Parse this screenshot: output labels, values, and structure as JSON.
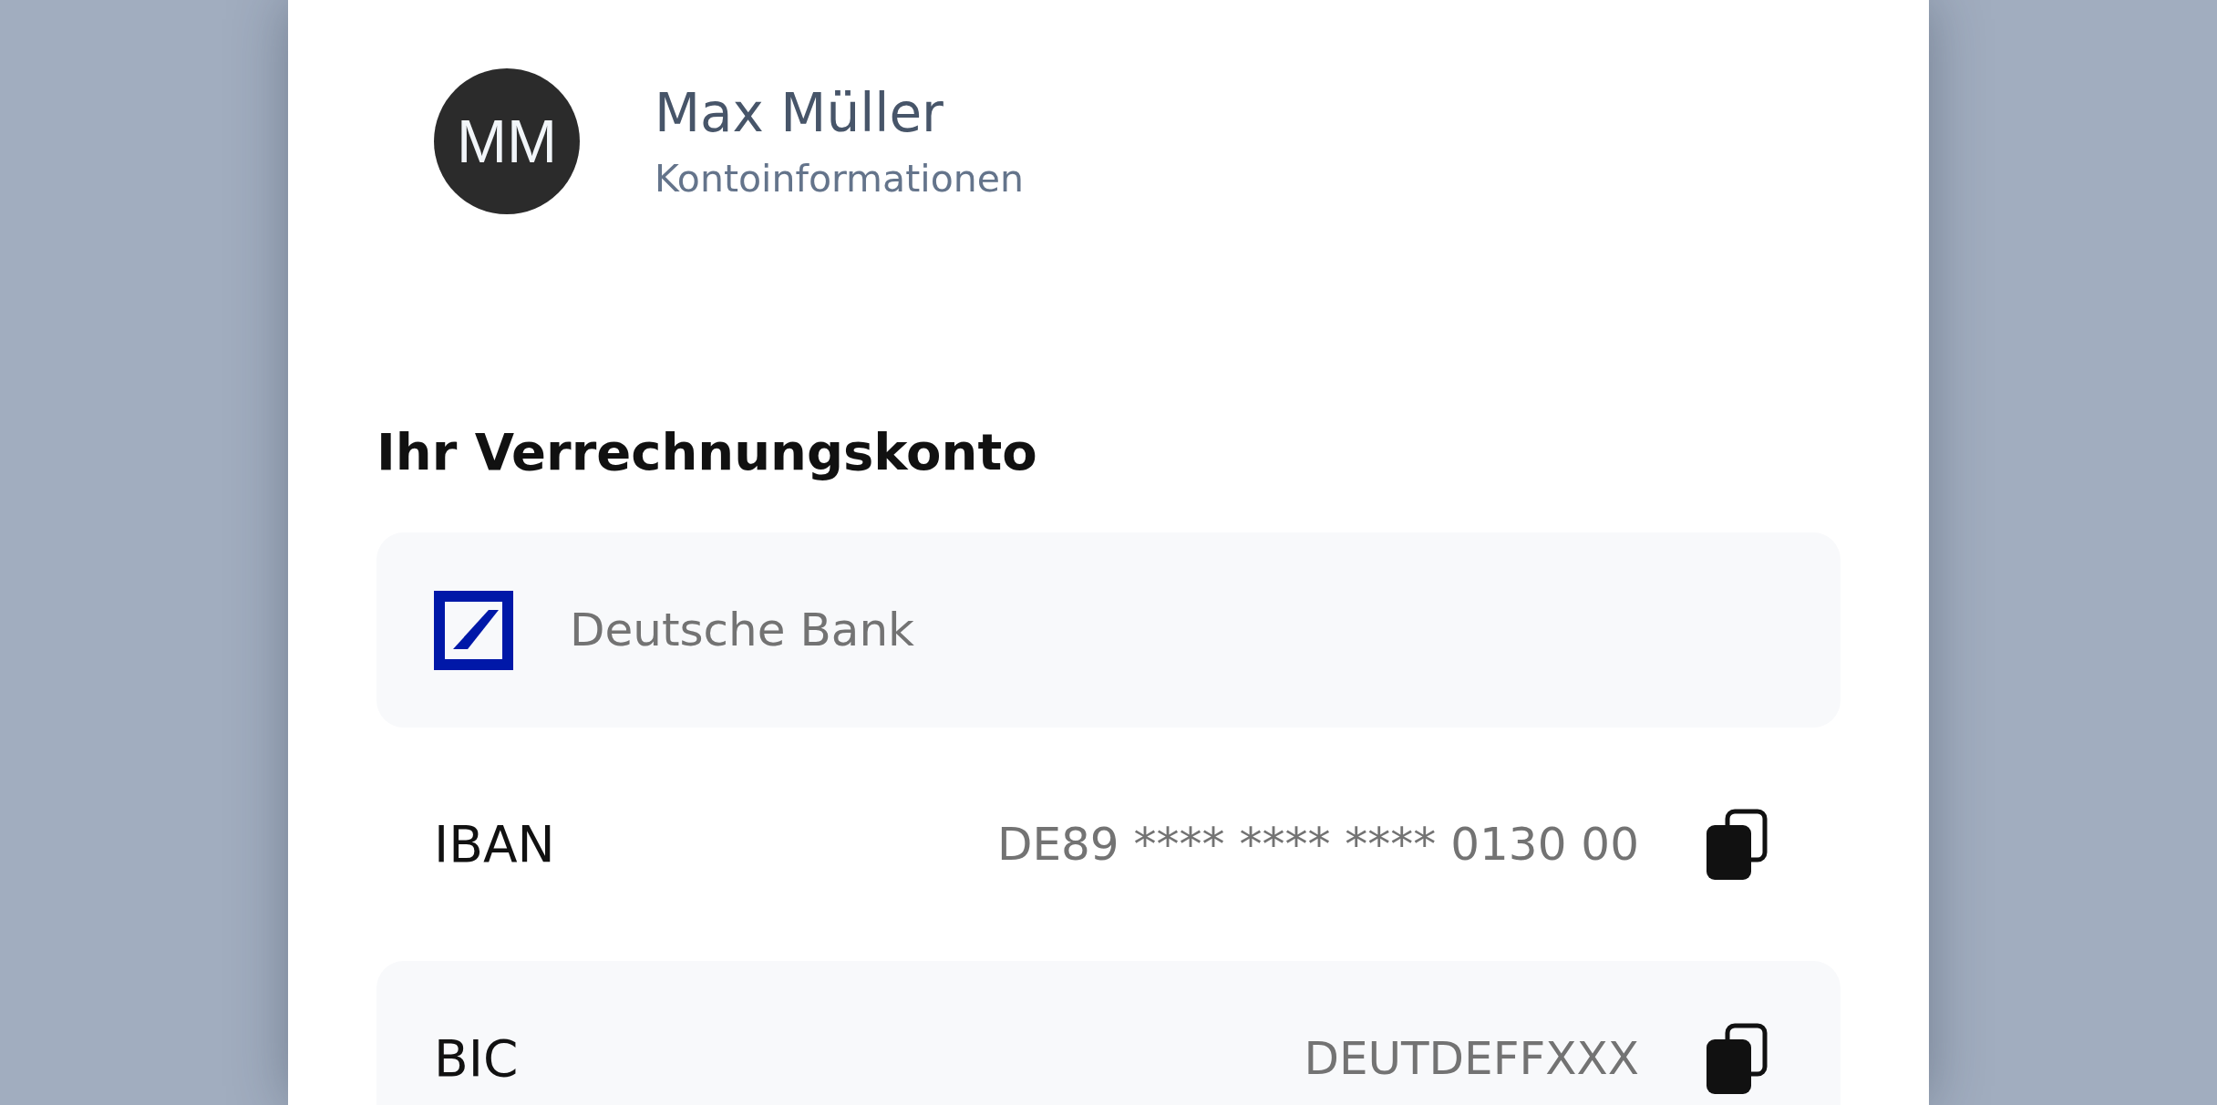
{
  "profile": {
    "initials": "MM",
    "name": "Max Müller",
    "subtitle": "Kontoinformationen"
  },
  "section_title": "Ihr Verrechnungskonto",
  "rows": [
    {
      "kind": "bank",
      "name": "Deutsche Bank"
    },
    {
      "kind": "field",
      "label": "IBAN",
      "value": "DE89 **** **** **** 0130 00"
    },
    {
      "kind": "field",
      "label": "BIC",
      "value": "DEUTDEFFXXX"
    }
  ]
}
